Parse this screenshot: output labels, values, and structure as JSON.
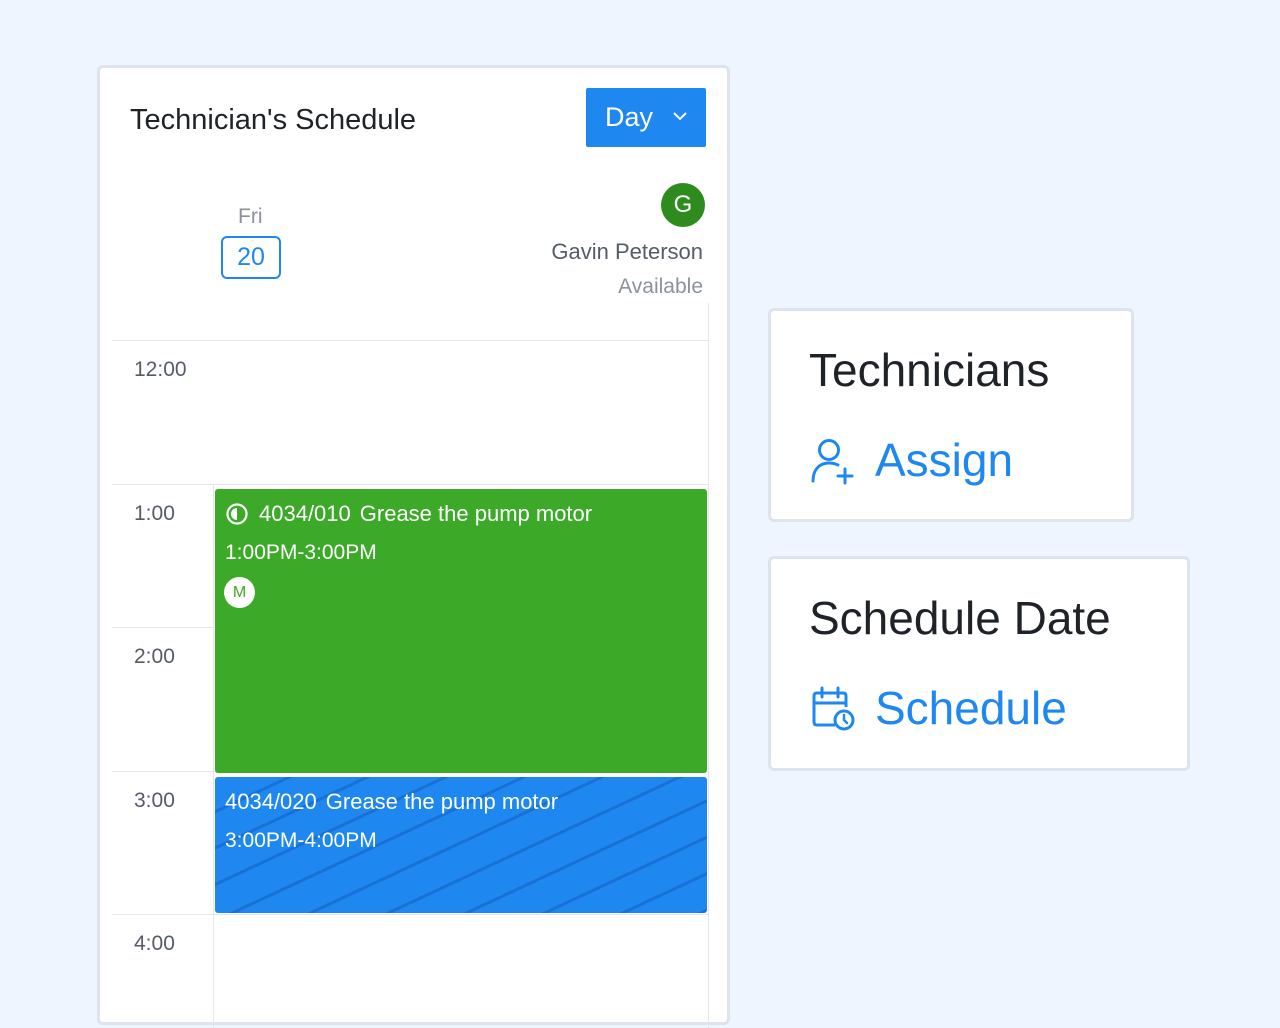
{
  "schedule": {
    "title": "Technician's Schedule",
    "view_selector": {
      "selected": "Day"
    },
    "day": {
      "name": "Fri",
      "number": "20"
    },
    "technician": {
      "initial": "G",
      "name": "Gavin Peterson",
      "status": "Available"
    },
    "time_labels": [
      "12:00",
      "1:00",
      "2:00",
      "3:00",
      "4:00"
    ],
    "events": [
      {
        "code": "4034/010",
        "title": "Grease the pump motor",
        "time": "1:00PM-3:00PM",
        "badge": "M",
        "color": "#3caa28"
      },
      {
        "code": "4034/020",
        "title": "Grease the pump motor",
        "time": "3:00PM-4:00PM",
        "color": "#1e88f0"
      }
    ]
  },
  "cards": {
    "technicians": {
      "title": "Technicians",
      "action": "Assign",
      "icon": "user-plus-icon"
    },
    "schedule_date": {
      "title": "Schedule Date",
      "action": "Schedule",
      "icon": "calendar-clock-icon"
    }
  },
  "colors": {
    "accent": "#1e88f0",
    "green": "#3caa28",
    "avatar": "#2e8b1e",
    "background": "#eef5fe"
  }
}
